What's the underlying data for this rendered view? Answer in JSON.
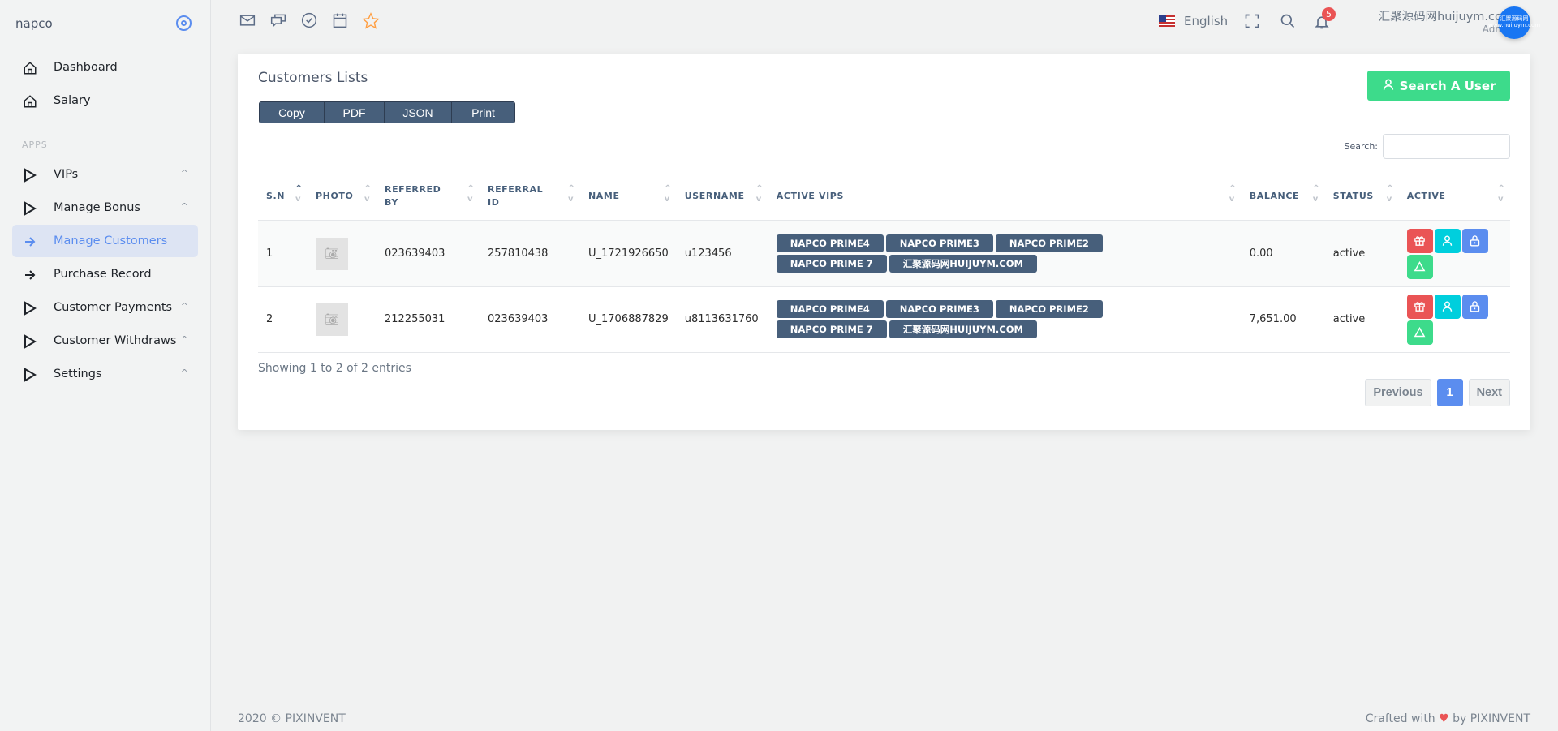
{
  "sidebar": {
    "brand": "napco",
    "section_label": "APPS",
    "items": [
      {
        "label": "Dashboard",
        "icon": "home-icon"
      },
      {
        "label": "Salary",
        "icon": "home-icon"
      },
      {
        "label": "VIPs",
        "icon": "play-triangle-icon",
        "chevron": "^"
      },
      {
        "label": "Manage Bonus",
        "icon": "play-triangle-icon",
        "chevron": "^"
      },
      {
        "label": "Manage Customers",
        "icon": "arrow-right-icon",
        "active": true
      },
      {
        "label": "Purchase Record",
        "icon": "arrow-right-icon"
      },
      {
        "label": "Customer Payments",
        "icon": "play-triangle-icon",
        "chevron": "^"
      },
      {
        "label": "Customer Withdraws",
        "icon": "play-triangle-icon",
        "chevron": "^"
      },
      {
        "label": "Settings",
        "icon": "play-triangle-icon",
        "chevron": "^"
      }
    ]
  },
  "topbar": {
    "language": "English",
    "notifications_count": "5",
    "user_name": "汇聚源码网huijuym.com",
    "user_role": "Admin",
    "avatar_text": "汇聚源码网 www.huijuym.com"
  },
  "card": {
    "title": "Customers Lists",
    "export_buttons": [
      "Copy",
      "PDF",
      "JSON",
      "Print"
    ],
    "search_user_label": "Search A User",
    "search_label": "Search:",
    "search_value": "",
    "columns": [
      "S.N",
      "PHOTO",
      "REFERRED BY",
      "REFERRAL ID",
      "NAME",
      "USERNAME",
      "ACTIVE VIPS",
      "BALANCE",
      "STATUS",
      "ACTIVE"
    ],
    "rows": [
      {
        "sn": "1",
        "referred_by": "023639403",
        "referral_id": "257810438",
        "name": "U_1721926650",
        "username": "u123456",
        "vips": [
          "NAPCO PRIME4",
          "NAPCO PRIME3",
          "NAPCO PRIME2",
          "NAPCO PRIME 7",
          "汇聚源码网HUIJUYM.COM"
        ],
        "balance": "0.00",
        "status": "active"
      },
      {
        "sn": "2",
        "referred_by": "212255031",
        "referral_id": "023639403",
        "name": "U_1706887829",
        "username": "u8113631760",
        "vips": [
          "NAPCO PRIME4",
          "NAPCO PRIME3",
          "NAPCO PRIME2",
          "NAPCO PRIME 7",
          "汇聚源码网HUIJUYM.COM"
        ],
        "balance": "7,651.00",
        "status": "active"
      }
    ],
    "info": "Showing 1 to 2 of 2 entries",
    "pagination": {
      "previous": "Previous",
      "current": "1",
      "next": "Next"
    }
  },
  "footer": {
    "left": "2020 © PIXINVENT",
    "right_prefix": "Crafted with",
    "right_suffix": "by PIXINVENT"
  },
  "colors": {
    "accent": "#5b8def",
    "success": "#3ddb8b",
    "danger": "#ea5455",
    "info": "#00cfdd",
    "badge_bg": "#475f7b"
  }
}
